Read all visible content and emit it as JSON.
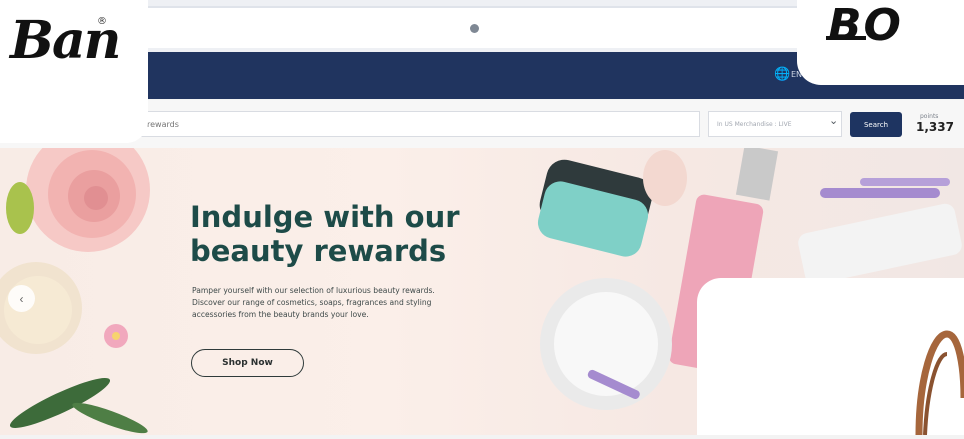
{
  "header": {
    "language": "EN"
  },
  "search": {
    "placeholder": "rewards",
    "catalog_select": "In US Merchandise : LIVE",
    "search_label": "Search",
    "points_label": "points",
    "points_value": "1,337"
  },
  "hero": {
    "headline_line1": "Indulge with our",
    "headline_line2": "beauty rewards",
    "body_line1": "Pamper yourself with our selection of luxurious beauty rewards.",
    "body_line2": "Discover our range of cosmetics, soaps, fragrances and styling",
    "body_line3": "accessories from the beauty brands your love.",
    "cta_label": "Shop Now",
    "prev_icon": "chevron-left-icon"
  },
  "logos": {
    "left_text": "Ban",
    "left_mark": "®",
    "right_text": "BO"
  },
  "colors": {
    "navbar": "#20345f",
    "headline": "#1d4b48",
    "search_button": "#1e3461"
  }
}
